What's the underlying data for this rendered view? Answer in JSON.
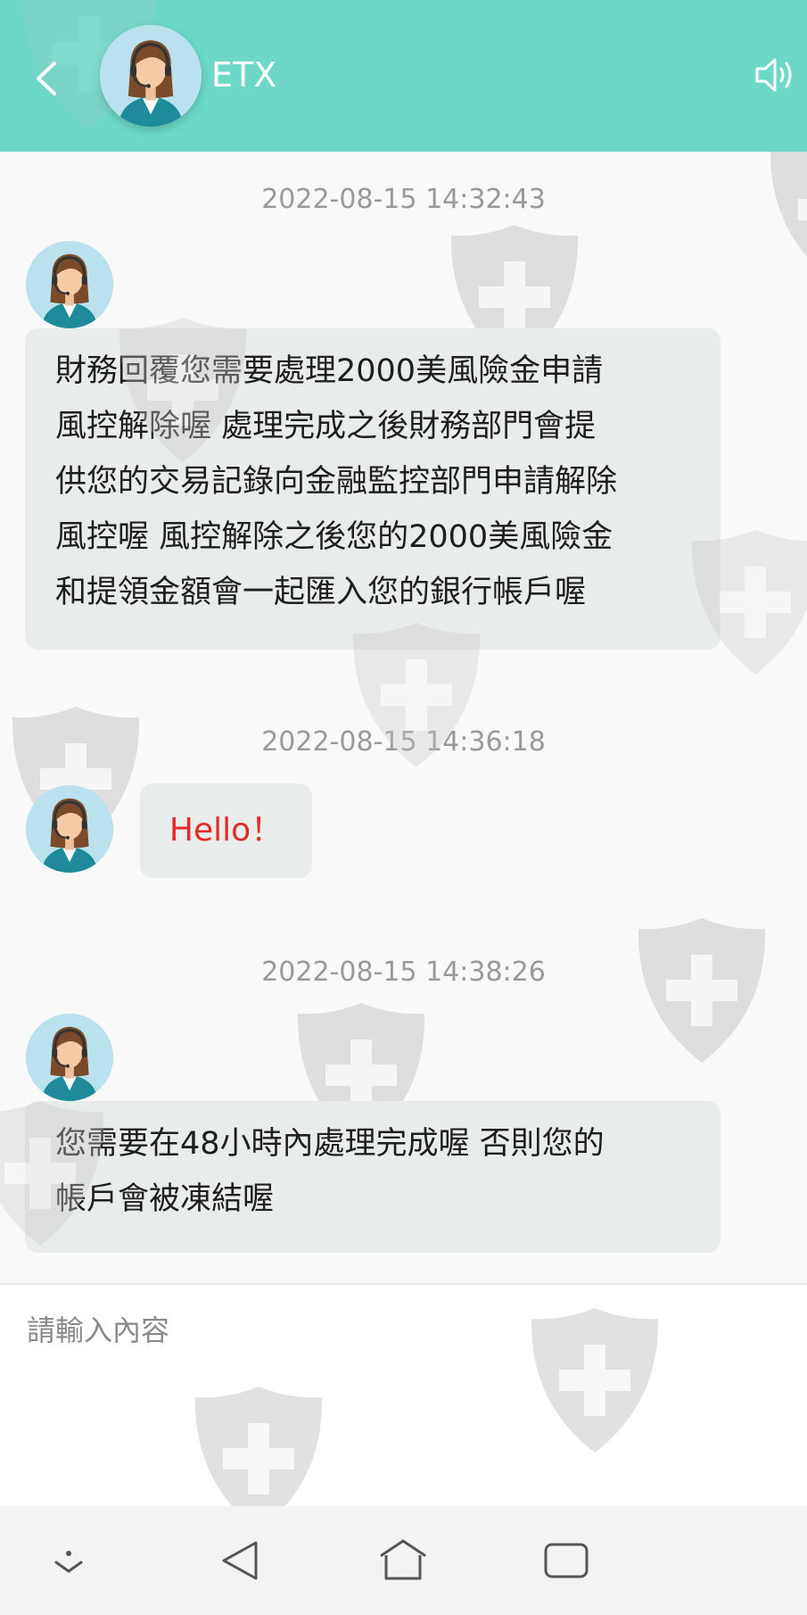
{
  "header": {
    "title": "ETX",
    "accent_color": "#6dd8c6",
    "back_icon": "chevron-left-icon",
    "speaker_icon": "speaker-icon"
  },
  "messages": [
    {
      "timestamp": "2022-08-15 14:32:43",
      "lines": [
        "財務回覆您需要處理2000美風險金申請",
        "風控解除喔 處理完成之後財務部門會提",
        "供您的交易記錄向金融監控部門申請解除",
        "風控喔 風控解除之後您的2000美風險金",
        "和提領金額會一起匯入您的銀行帳戶喔"
      ]
    },
    {
      "timestamp": "2022-08-15 14:36:18",
      "lines": [
        "Hello！"
      ],
      "text_color": "#e62a28"
    },
    {
      "timestamp": "2022-08-15 14:38:26",
      "lines": [
        "您需要在48小時內處理完成喔 否則您的",
        "帳戶會被凍結喔"
      ]
    }
  ],
  "input": {
    "placeholder": "請輸入內容",
    "value": ""
  },
  "navbar": {
    "icons": [
      "hide-keyboard-icon",
      "back-triangle-icon",
      "home-icon",
      "recents-icon"
    ]
  }
}
